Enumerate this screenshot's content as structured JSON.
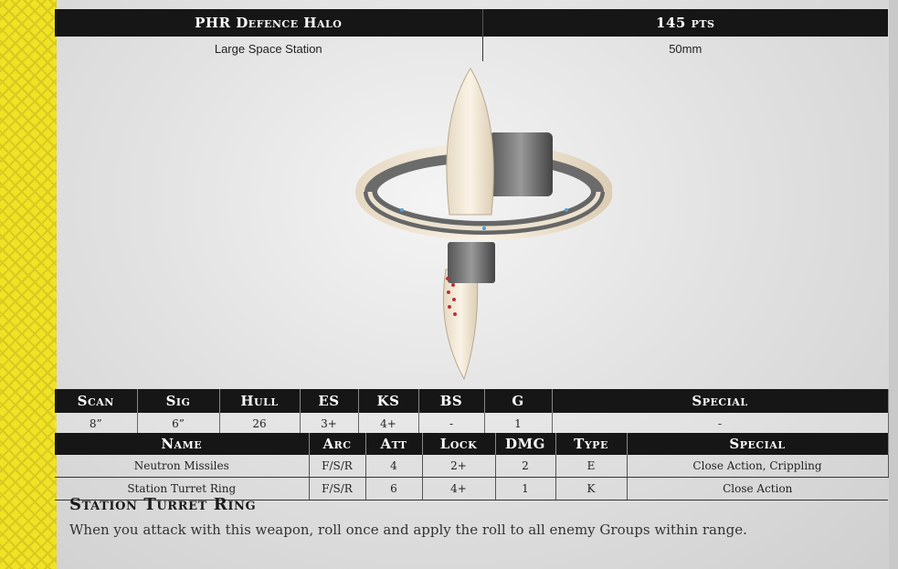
{
  "header": {
    "name": "PHR Defence Halo",
    "points": "145 pts",
    "type": "Large Space Station",
    "base": "50mm"
  },
  "stats": {
    "headers": [
      "Scan",
      "Sig",
      "Hull",
      "ES",
      "KS",
      "BS",
      "G",
      "Special"
    ],
    "values": [
      "8”",
      "6”",
      "26",
      "3+",
      "4+",
      "-",
      "1",
      "-"
    ]
  },
  "weapons": {
    "headers": [
      "Name",
      "Arc",
      "Att",
      "Lock",
      "DMG",
      "Type",
      "Special"
    ],
    "rows": [
      [
        "Neutron Missiles",
        "F/S/R",
        "4",
        "2+",
        "2",
        "E",
        "Close Action, Crippling"
      ],
      [
        "Station Turret Ring",
        "F/S/R",
        "6",
        "4+",
        "1",
        "K",
        "Close Action"
      ]
    ]
  },
  "rule": {
    "title": "Station Turret Ring",
    "text": "When you attack with this weapon, roll once and apply the roll to all enemy Groups within range."
  },
  "colors": {
    "accent_stripe": "#f0e224",
    "header_bg": "#161616",
    "hull_color": "#f3e9d8"
  }
}
